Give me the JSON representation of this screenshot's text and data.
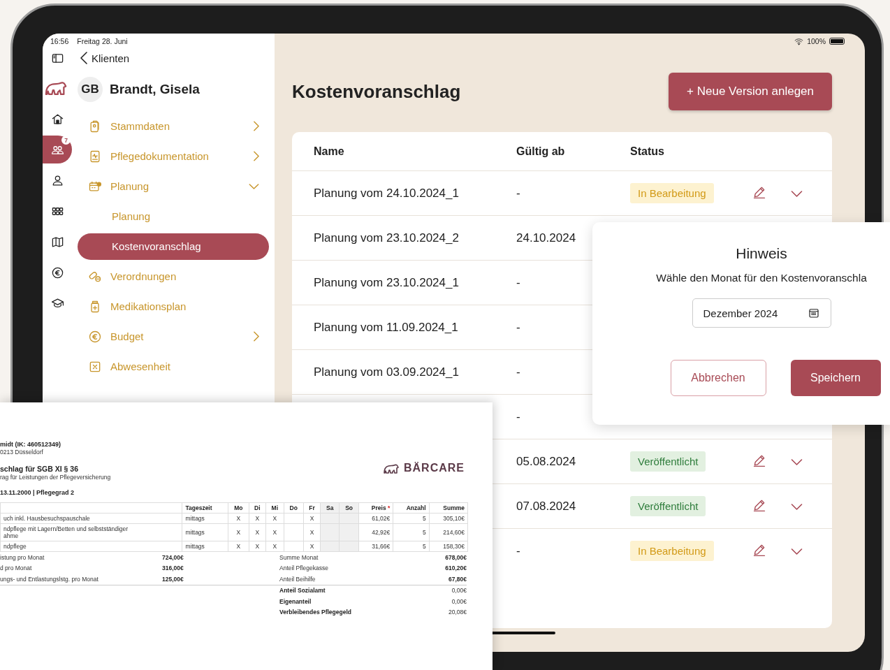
{
  "status_bar": {
    "time": "16:56",
    "date": "Freitag 28. Juni",
    "battery": "100%"
  },
  "rail_items": [
    {
      "selected": false
    },
    {
      "selected": false
    },
    {
      "selected": true,
      "badge": "7"
    },
    {
      "selected": false
    },
    {
      "selected": false
    },
    {
      "selected": false
    },
    {
      "selected": false
    },
    {
      "selected": false
    }
  ],
  "sidebar": {
    "back": "Klienten",
    "client": {
      "initials": "GB",
      "name": "Brandt, Gisela"
    },
    "items": [
      {
        "label": "Stammdaten",
        "selected": false,
        "expanded": false
      },
      {
        "label": "Pflegedokumentation",
        "selected": false,
        "expanded": false
      },
      {
        "label": "Planung",
        "selected": false,
        "expanded": true,
        "children": [
          {
            "label": "Planung",
            "selected": false
          },
          {
            "label": "Kostenvoranschlag",
            "selected": true
          }
        ]
      },
      {
        "label": "Verordnungen",
        "selected": false
      },
      {
        "label": "Medikationsplan",
        "selected": false
      },
      {
        "label": "Budget",
        "selected": false,
        "expanded": false
      },
      {
        "label": "Abwesenheit",
        "selected": false
      }
    ]
  },
  "main": {
    "title": "Kostenvoranschlag",
    "new_button": "+ Neue Version anlegen",
    "table": {
      "columns": [
        "Name",
        "Gültig ab",
        "Status"
      ],
      "rows": [
        {
          "name": "Planung vom 24.10.2024_1",
          "valid_from": "-",
          "status": {
            "kind": "draft",
            "label": "In Bearbeitung"
          }
        },
        {
          "name": "Planung vom 23.10.2024_2",
          "valid_from": "24.10.2024"
        },
        {
          "name": "Planung vom 23.10.2024_1",
          "valid_from": "-"
        },
        {
          "name": "Planung vom 11.09.2024_1",
          "valid_from": "-"
        },
        {
          "name": "Planung vom 03.09.2024_1",
          "valid_from": "-"
        },
        {
          "valid_from": "-"
        },
        {
          "valid_from": "05.08.2024",
          "status": {
            "kind": "published",
            "label": "Veröffentlicht"
          }
        },
        {
          "valid_from": "07.08.2024",
          "status": {
            "kind": "published",
            "label": "Veröffentlicht"
          }
        },
        {
          "valid_from": "-",
          "status": {
            "kind": "draft",
            "label": "In Bearbeitung"
          }
        }
      ]
    }
  },
  "dialog": {
    "title": "Hinweis",
    "message": "Wähle den Monat für den Kostenvoranschla",
    "month_field": "Dezember 2024",
    "buttons": [
      {
        "kind": "secondary",
        "label": "Abbrechen"
      },
      {
        "kind": "primary",
        "label": "Speichern"
      }
    ]
  },
  "document": {
    "header_lines": [
      {
        "kind": "strong",
        "text": "midt (IK: 460512349)"
      },
      {
        "kind": "plain",
        "text": "0213 Düsseldorf"
      },
      {
        "kind": "heading",
        "text": "schlag für SGB XI § 36"
      },
      {
        "kind": "plain",
        "text": "rag für Leistungen der Pflegeversicherung"
      },
      {
        "kind": "strong",
        "text": "13.11.2000 | Pflegegrad 2"
      }
    ],
    "logo": "BÄRCARE",
    "columns": [
      "",
      "Tageszeit",
      "Mo",
      "Di",
      "Mi",
      "Do",
      "Fr",
      "Sa",
      "So",
      "Preis",
      "Anzahl",
      "Summe"
    ],
    "price_mark": "*",
    "rows": [
      [
        "uch inkl. Hausbesuchspauschale",
        "mittags",
        "X",
        "X",
        "X",
        null,
        "X",
        null,
        null,
        "61,02€",
        "5",
        "305,10€"
      ],
      [
        "ndpflege mit Lagern/Betten und selbstständiger\nahme",
        "mittags",
        "X",
        "X",
        "X",
        null,
        "X",
        null,
        null,
        "42,92€",
        "5",
        "214,60€"
      ],
      [
        "ndpflege",
        "mittags",
        "X",
        "X",
        "X",
        null,
        "X",
        null,
        null,
        "31,66€",
        "5",
        "158,30€"
      ]
    ],
    "summary": [
      {
        "left_label": "istung pro Monat",
        "left_amount": "724,00€",
        "right_label": "Summe Monat",
        "right_amount": "678,00€",
        "emphasis": false
      },
      {
        "left_label": "d pro Monat",
        "left_amount": "316,00€",
        "right_label": "Anteil Pflegekasse",
        "right_amount": "610,20€",
        "emphasis": false
      },
      {
        "left_label": "ungs- und Entlastungslstg. pro Monat",
        "left_amount": "125,00€",
        "right_label": "Anteil Beihilfe",
        "right_amount": "67,80€",
        "emphasis": false
      },
      {
        "right_label": "Anteil Sozialamt",
        "right_amount": "0,00€",
        "emphasis": true
      },
      {
        "right_label": "Eigenanteil",
        "right_amount": "0,00€",
        "emphasis": true
      },
      {
        "right_label": "Verbleibendes Pflegegeld",
        "right_amount": "20,08€",
        "emphasis": true
      }
    ]
  }
}
